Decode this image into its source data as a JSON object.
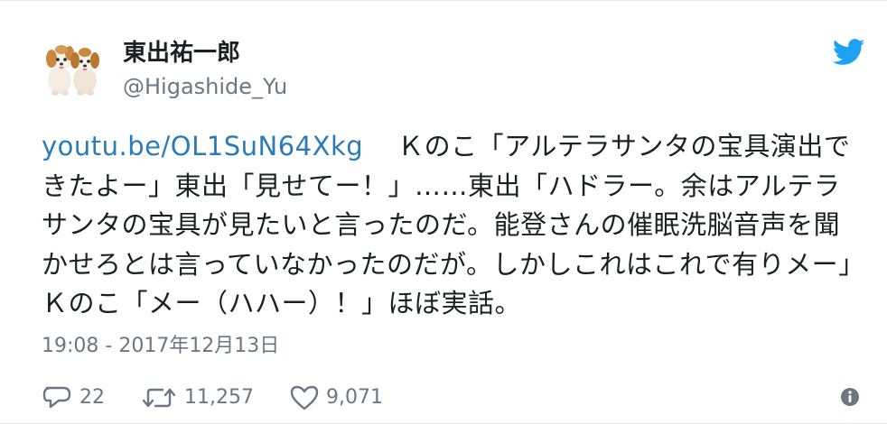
{
  "user": {
    "display_name": "東出祐一郎",
    "username": "@Higashide_Yu",
    "avatar": "puppies-avatar-icon"
  },
  "brand": {
    "accent_color": "#1da1f2",
    "link_color": "#2b7bb9",
    "secondary_text_color": "#697882",
    "logo": "twitter-bird-icon"
  },
  "tweet": {
    "link": "youtu.be/OL1SuN64Xkg",
    "text": "Ｋのこ「アルテラサンタの宝具演出できたよー」東出「見せてー！」……東出「ハドラー。余はアルテラサンタの宝具が見たいと言ったのだ。能登さんの催眠洗脳音声を聞かせろとは言っていなかったのだが。しかしこれはこれで有りメー」Ｋのこ「メー（ハハー）！」ほぼ実話。",
    "timestamp": "19:08 - 2017年12月13日"
  },
  "actions": {
    "reply": {
      "icon": "reply-icon",
      "count": "22"
    },
    "retweet": {
      "icon": "retweet-icon",
      "count": "11,257"
    },
    "like": {
      "icon": "heart-icon",
      "count": "9,071"
    },
    "info": {
      "icon": "info-icon"
    }
  }
}
